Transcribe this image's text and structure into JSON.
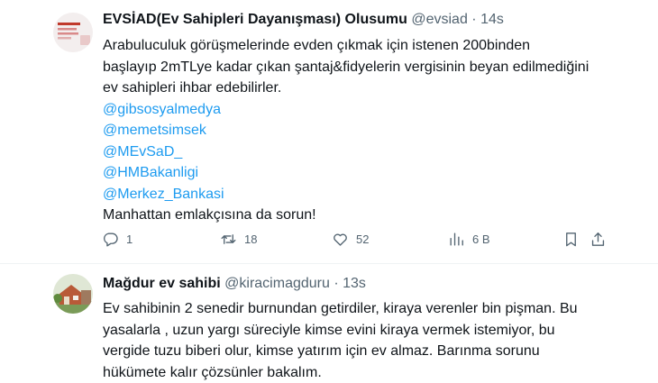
{
  "tweet1": {
    "name": "EVSİAD(Ev Sahipleri Dayanışması) Olusumu",
    "handle": "@evsiad",
    "dot": "·",
    "time": "14s",
    "lines": [
      "Arabuluculuk görüşmelerinde evden çıkmak için istenen 200binden",
      "başlayıp 2mTLye kadar çıkan şantaj&fidyelerin vergisinin beyan edilmediğini",
      "ev sahipleri ihbar edebilirler."
    ],
    "mentions": [
      "@gibsosyalmedya",
      "@memetsimsek",
      "@MEvSaD_",
      "@HMBakanligi",
      "@Merkez_Bankasi"
    ],
    "closing": "Manhattan emlakçısına da sorun!",
    "actions": {
      "reply": {
        "icon": "reply-icon",
        "count": "1"
      },
      "retweet": {
        "icon": "retweet-icon",
        "count": "18"
      },
      "like": {
        "icon": "heart-icon",
        "count": "52"
      },
      "views": {
        "icon": "views-icon",
        "count": "6 B"
      },
      "bookmark": {
        "icon": "bookmark-icon"
      },
      "share": {
        "icon": "share-icon"
      }
    }
  },
  "tweet2": {
    "name": "Mağdur ev sahibi",
    "handle": "@kiracimagduru",
    "dot": "·",
    "time": "13s",
    "lines": [
      "Ev sahibinin 2 senedir burnundan getirdiler, kiraya verenler bin pişman. Bu",
      "yasalarla , uzun yargı süreciyle kimse evini kiraya vermek istemiyor, bu",
      "vergide tuzu biberi olur, kimse yatırım için ev almaz. Barınma sorunu",
      "hükümete kalır çözsünler bakalım."
    ]
  },
  "colors": {
    "text": "#0f1419",
    "secondary": "#536471",
    "link": "#1d9bf0",
    "divider": "#eff3f4"
  }
}
